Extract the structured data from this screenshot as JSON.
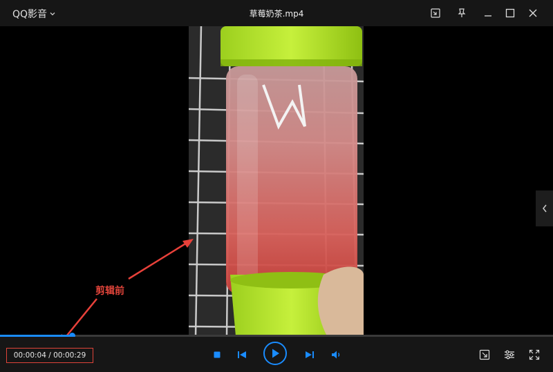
{
  "titlebar": {
    "app_name": "QQ影音",
    "file_title": "草莓奶茶.mp4",
    "icons": [
      "mini-mode-icon",
      "pin-icon",
      "minimize-icon",
      "maximize-icon",
      "close-icon"
    ]
  },
  "annotation": {
    "text": "剪辑前",
    "color": "#e0443a"
  },
  "player": {
    "time_display": "00:00:04 / 00:00:29",
    "progress_fraction": 0.13,
    "accent_color": "#1a8cff"
  },
  "controls": {
    "icons": [
      "stop-icon",
      "previous-icon",
      "play-icon",
      "next-icon",
      "volume-icon",
      "screenshot-icon",
      "settings-icon",
      "fullscreen-icon"
    ]
  },
  "side_panel": {
    "icon": "chevron-left-icon"
  }
}
